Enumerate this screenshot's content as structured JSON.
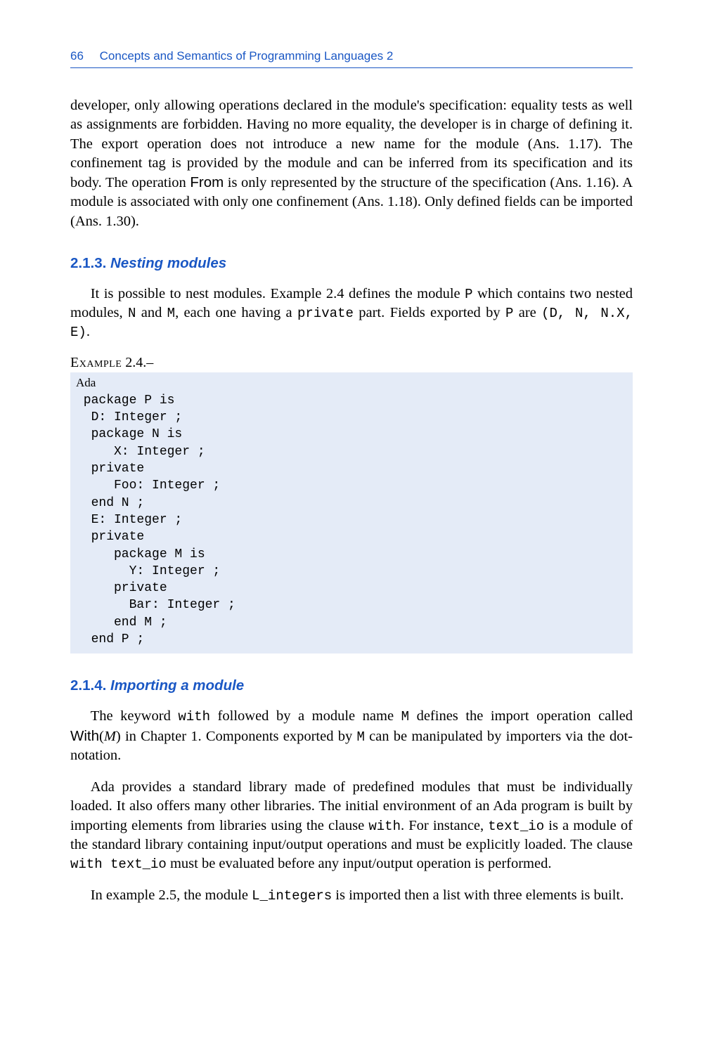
{
  "header": {
    "page_num": "66",
    "title": "Concepts and Semantics of Programming Languages 2"
  },
  "p1": {
    "t1": "developer, only allowing operations declared in the module's specification: equality tests as well as assignments are forbidden. Having no more equality, the developer is in charge of defining it. The export operation does not introduce a new name for the module (Ans. 1.17). The confinement tag is provided by the module and can be inferred from its specification and its body. The operation ",
    "from": "From",
    "t2": " is only represented by the structure of the specification (Ans. 1.16). A module is associated with only one confinement (Ans. 1.18). Only defined fields can be imported (Ans. 1.30)."
  },
  "sec213": {
    "num": "2.1.3.",
    "title": "Nesting modules"
  },
  "p2": {
    "t1": "It is possible to nest modules. Example 2.4 defines the module ",
    "P": "P",
    "t2": " which contains two nested modules, ",
    "N": "N",
    "t3": " and ",
    "M": "M",
    "t4": ", each one having a ",
    "priv": "private",
    "t5": " part. Fields exported by ",
    "P2": "P",
    "t6": " are ",
    "fields": "(D, N, N.X, E)",
    "t7": "."
  },
  "ex24": {
    "label_sc": "Example",
    "label_rest": " 2.4.–",
    "lang": "Ada",
    "code": " package P is\n  D: Integer ;\n  package N is\n     X: Integer ;\n  private\n     Foo: Integer ;\n  end N ;\n  E: Integer ;\n  private\n     package M is\n       Y: Integer ;\n     private\n       Bar: Integer ;\n     end M ;\n  end P ;"
  },
  "sec214": {
    "num": "2.1.4.",
    "title": "Importing a module"
  },
  "p3": {
    "t1": "The keyword ",
    "with": "with",
    "t2": " followed by a module name ",
    "M": "M",
    "t3": " defines the import operation called ",
    "With": "With",
    "paren_open": "(",
    "Marg": "M",
    "paren_close": ")",
    "t4": " in Chapter 1. Components exported by ",
    "M2": "M",
    "t5": " can be manipulated by importers via the dot-notation."
  },
  "p4": {
    "t1": "Ada provides a standard library made of predefined modules that must be individually loaded. It also offers many other libraries. The initial environment of an Ada program is built by importing elements from libraries using the clause ",
    "with": "with",
    "t2": ". For instance, ",
    "textio": "text_io",
    "t3": " is a module of the standard library containing input/output operations and must be explicitly loaded. The clause ",
    "withclause": "with text_io",
    "t4": " must be evaluated before any input/output operation is performed."
  },
  "p5": {
    "t1": "In example 2.5, the module ",
    "Lint": "L_integers",
    "t2": " is imported then a list with three elements is built."
  }
}
